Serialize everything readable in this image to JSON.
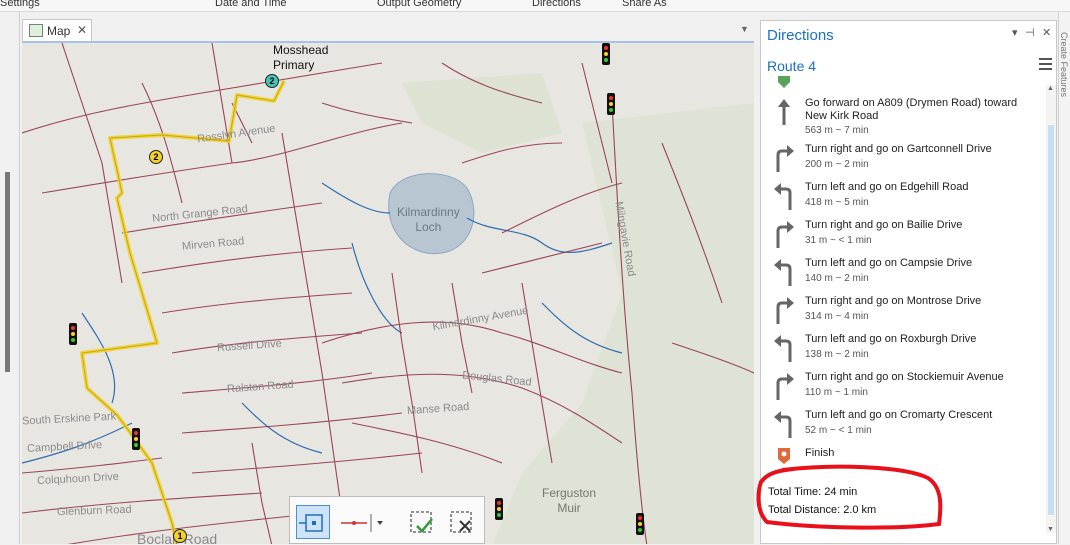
{
  "ribbon": {
    "groups": [
      "Settings",
      "Date and Time",
      "Output Geometry",
      "Directions",
      "Share As"
    ]
  },
  "map_tab": {
    "label": "Map",
    "close": "✕"
  },
  "map": {
    "poi_label": "Mosshead\nPrimary",
    "water_label": "Kilmardinny\nLoch",
    "area_label": "Ferguston\nMuir",
    "street_labels": [
      "Rosslyn Avenue",
      "North Grange Road",
      "Mirven Road",
      "Russell Drive",
      "Ralston Road",
      "Manse Road",
      "Douglas Road",
      "Kilmardinny Avenue",
      "Milngavie Road",
      "South Erskine Park",
      "Campbell Drive",
      "Colquhoun Drive",
      "Glenburn Road",
      "Boclair Road"
    ],
    "stops": [
      "1",
      "2",
      "2"
    ]
  },
  "directions_panel": {
    "title": "Directions",
    "pin": "⊣",
    "close": "✕",
    "dropdown": "▾",
    "route_name": "Route 4",
    "steps": [
      {
        "text": "Go forward on A809 (Drymen Road) toward New Kirk Road",
        "detail": "563 m ~ 7 min",
        "icon": "straight-arrow-icon"
      },
      {
        "text": "Turn right and go on Gartconnell Drive",
        "detail": "200 m ~ 2 min",
        "icon": "turn-right-icon"
      },
      {
        "text": "Turn left and go on Edgehill Road",
        "detail": "418 m ~ 5 min",
        "icon": "turn-left-icon"
      },
      {
        "text": "Turn right and go on Bailie Drive",
        "detail": "31 m ~ < 1 min",
        "icon": "turn-right-icon"
      },
      {
        "text": "Turn left and go on Campsie Drive",
        "detail": "140 m ~ 2 min",
        "icon": "turn-left-icon"
      },
      {
        "text": "Turn right and go on Montrose Drive",
        "detail": "314 m ~ 4 min",
        "icon": "turn-right-icon"
      },
      {
        "text": "Turn left and go on Roxburgh Drive",
        "detail": "138 m ~ 2 min",
        "icon": "turn-left-icon"
      },
      {
        "text": "Turn right and go on Stockiemuir Avenue",
        "detail": "110 m ~ 1 min",
        "icon": "turn-right-icon"
      },
      {
        "text": "Turn left and go on Cromarty Crescent",
        "detail": "52 m ~ < 1 min",
        "icon": "turn-left-icon"
      }
    ],
    "finish_label": "Finish",
    "total_time": "Total Time: 24 min",
    "total_distance": "Total Distance: 2.0 km"
  },
  "side_strip_label": "Create Features",
  "colors": {
    "route": "#f2d22a",
    "accent": "#1a6fc4",
    "annotation": "#e8101a"
  }
}
